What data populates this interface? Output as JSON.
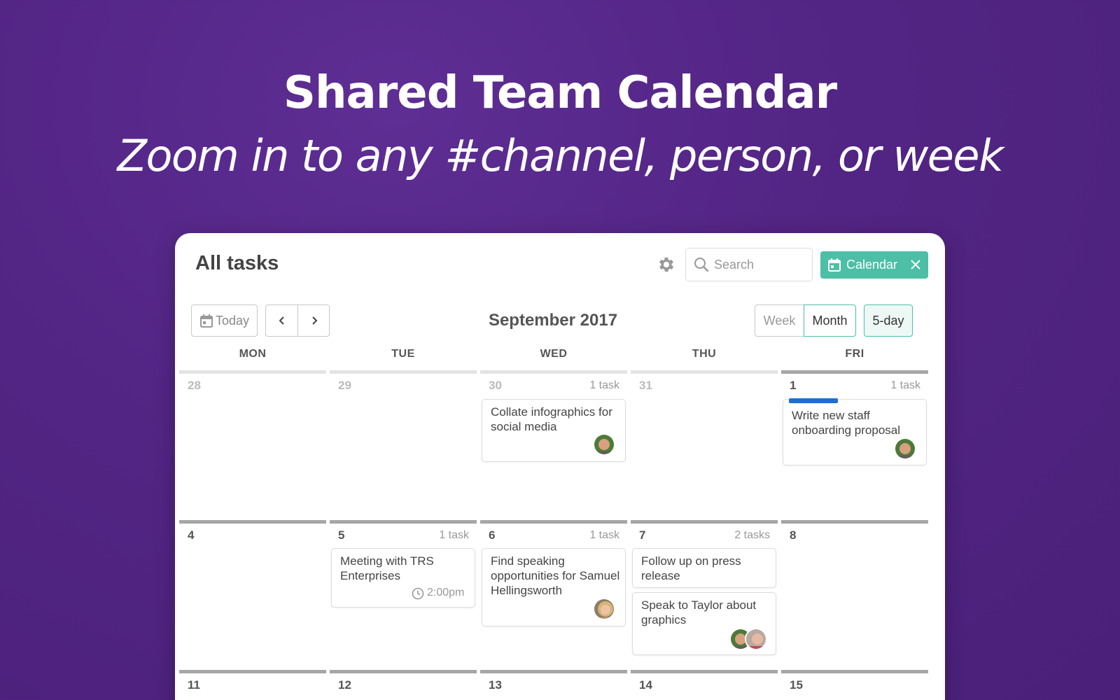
{
  "hero": {
    "title": "Shared Team Calendar",
    "subtitle": "Zoom in to any #channel, person, or week"
  },
  "header": {
    "title": "All tasks",
    "search_placeholder": "Search",
    "filter_chip_label": "Calendar"
  },
  "toolbar": {
    "today_label": "Today",
    "month_label": "September 2017",
    "views": {
      "week": "Week",
      "month": "Month",
      "five_day": "5-day"
    }
  },
  "weekdays": [
    "MON",
    "TUE",
    "WED",
    "THU",
    "FRI"
  ],
  "weeks": [
    {
      "days": [
        {
          "date": "28",
          "count": "",
          "faded": true
        },
        {
          "date": "29",
          "count": "",
          "faded": true
        },
        {
          "date": "30",
          "count": "1 task",
          "faded": true
        },
        {
          "date": "31",
          "count": "",
          "faded": true
        },
        {
          "date": "1",
          "count": "1 task",
          "faded": false
        }
      ]
    },
    {
      "days": [
        {
          "date": "4",
          "count": ""
        },
        {
          "date": "5",
          "count": "1 task"
        },
        {
          "date": "6",
          "count": "1 task"
        },
        {
          "date": "7",
          "count": "2 tasks"
        },
        {
          "date": "8",
          "count": ""
        }
      ]
    },
    {
      "days": [
        {
          "date": "11",
          "count": ""
        },
        {
          "date": "12",
          "count": ""
        },
        {
          "date": "13",
          "count": ""
        },
        {
          "date": "14",
          "count": ""
        },
        {
          "date": "15",
          "count": ""
        }
      ]
    }
  ],
  "tasks": {
    "collate": "Collate infographics for social media",
    "staff_onboarding": "Write new staff onboarding proposal",
    "trs_meeting": "Meeting with TRS Enterprises",
    "trs_time": "2:00pm",
    "speaking": "Find speaking opportunities for Samuel Hellingsworth",
    "press": "Follow up on press release",
    "taylor": "Speak to Taylor about graphics"
  },
  "colors": {
    "accent": "#4cbfa6",
    "priority_bar": "#1c6fd1",
    "background": "#532585"
  }
}
